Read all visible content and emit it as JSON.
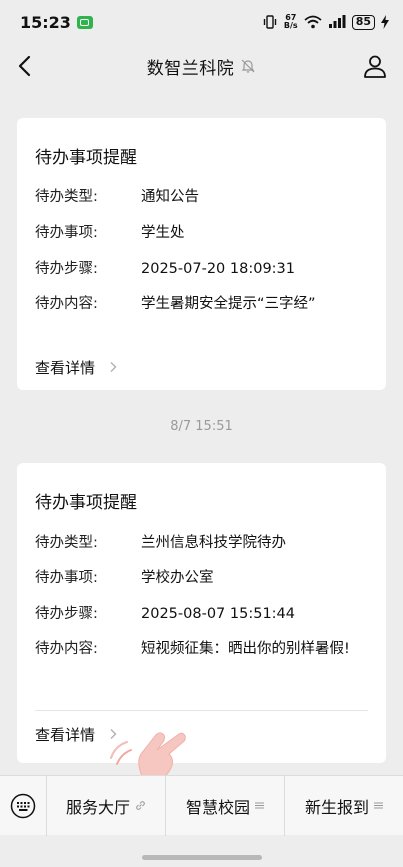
{
  "status_bar": {
    "time": "15:23",
    "net_speed_top": "67",
    "net_speed_bottom": "B/s",
    "battery": "85"
  },
  "nav": {
    "title": "数智兰科院"
  },
  "cards": [
    {
      "title": "待办事项提醒",
      "rows": [
        {
          "label": "待办类型:",
          "value": "通知公告"
        },
        {
          "label": "待办事项:",
          "value": "学生处"
        },
        {
          "label": "待办步骤:",
          "value": "2025-07-20 18:09:31"
        },
        {
          "label": "待办内容:",
          "value": "学生暑期安全提示“三字经”"
        }
      ],
      "detail_label": "查看详情"
    },
    {
      "title": "待办事项提醒",
      "rows": [
        {
          "label": "待办类型:",
          "value": "兰州信息科技学院待办"
        },
        {
          "label": "待办事项:",
          "value": "学校办公室"
        },
        {
          "label": "待办步骤:",
          "value": "2025-08-07 15:51:44"
        },
        {
          "label": "待办内容:",
          "value": "短视频征集：晒出你的别样暑假!"
        }
      ],
      "detail_label": "查看详情"
    }
  ],
  "timestamp": "8/7 15:51",
  "bottom_menu": {
    "items": [
      {
        "label": "服务大厅",
        "mark_icon": "link-icon"
      },
      {
        "label": "智慧校园",
        "mark_icon": "menu-lines-icon"
      },
      {
        "label": "新生报到",
        "mark_icon": "menu-lines-icon"
      }
    ]
  },
  "colors": {
    "background": "#ededed",
    "card": "#ffffff",
    "status_app_badge": "#2fb34d",
    "hand": "#f6c7c0"
  }
}
